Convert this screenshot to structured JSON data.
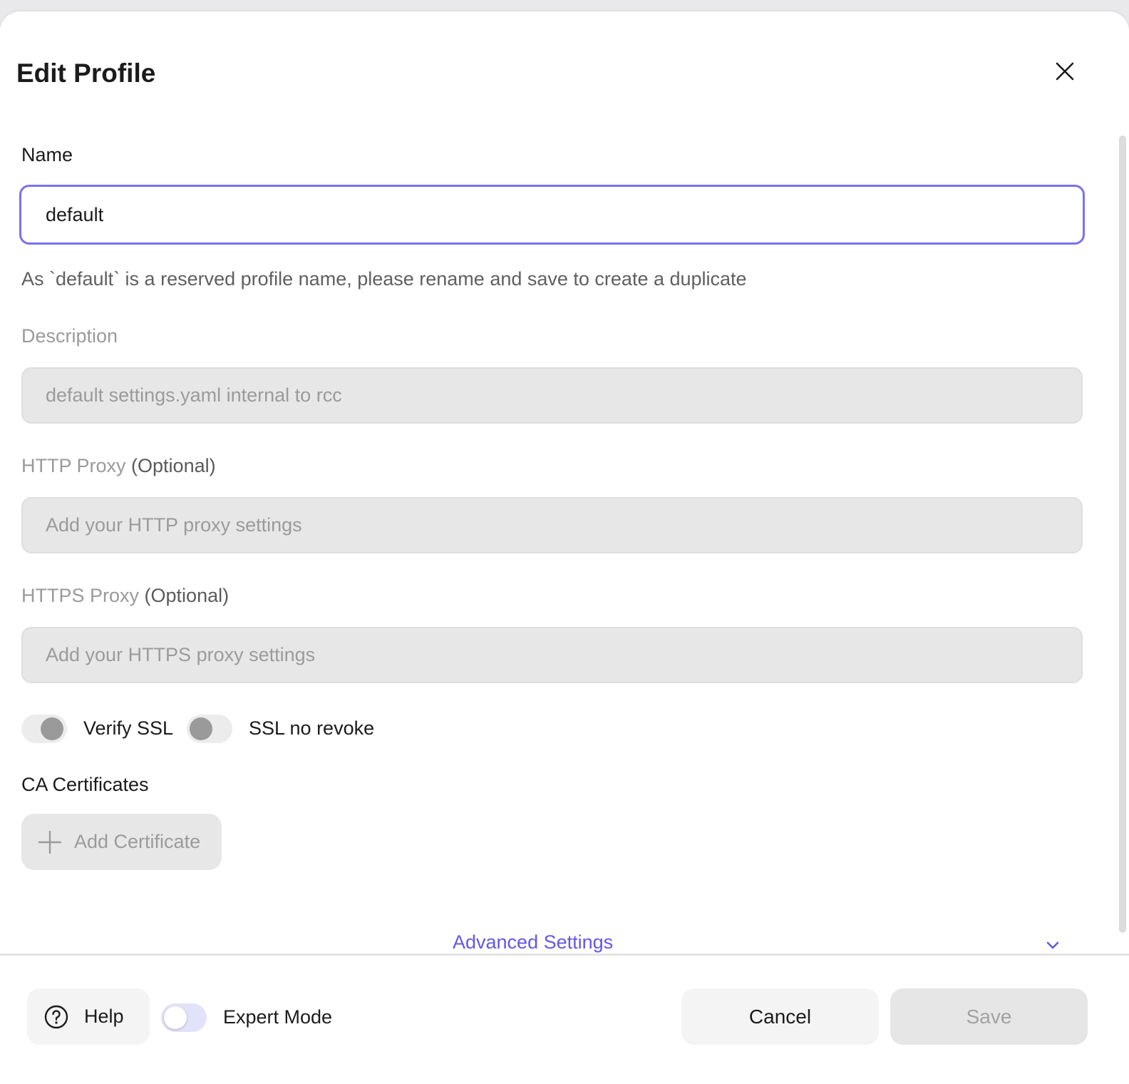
{
  "dialog": {
    "title": "Edit Profile",
    "close_icon": "close-icon"
  },
  "form": {
    "name": {
      "label": "Name",
      "value": "default",
      "hint": "As `default` is a reserved profile name, please rename and save to create a duplicate"
    },
    "description": {
      "label": "Description",
      "value": "default settings.yaml internal to rcc"
    },
    "http_proxy": {
      "label": "HTTP Proxy",
      "optional": "(Optional)",
      "placeholder": "Add your HTTP proxy settings"
    },
    "https_proxy": {
      "label": "HTTPS Proxy",
      "optional": "(Optional)",
      "placeholder": "Add your HTTPS proxy settings"
    },
    "verify_ssl": {
      "label": "Verify SSL",
      "checked": false
    },
    "ssl_no_revoke": {
      "label": "SSL no revoke",
      "checked": false
    },
    "ca_certificates": {
      "label": "CA Certificates",
      "add_button": "Add Certificate",
      "add_icon": "plus-icon"
    },
    "advanced": {
      "label": "Advanced Settings",
      "icon": "chevron-down-icon"
    }
  },
  "footer": {
    "help_label": "Help",
    "help_icon": "question-circle-icon",
    "expert_mode": {
      "label": "Expert Mode",
      "checked": false
    },
    "cancel_label": "Cancel",
    "save_label": "Save"
  },
  "colors": {
    "accent": "#7a72ee",
    "link": "#6358e6",
    "disabled_bg": "#e7e7e7",
    "disabled_text": "#9b9b9b"
  }
}
